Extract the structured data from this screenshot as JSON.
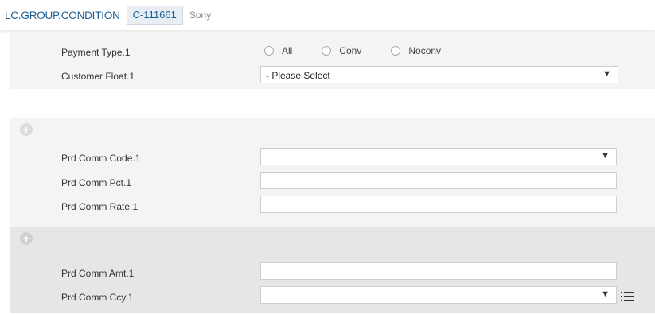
{
  "header": {
    "app_title": "LC.GROUP.CONDITION",
    "record_id": "C-111661",
    "record_name": "Sony"
  },
  "section1": {
    "payment_type_label": "Payment Type.1",
    "payment_type_options": [
      "All",
      "Conv",
      "Noconv"
    ],
    "customer_float_label": "Customer Float.1",
    "customer_float_value": "- Please Select"
  },
  "section2": {
    "add_icon": "plus-circle-icon",
    "prd_comm_code_label": "Prd Comm Code.1",
    "prd_comm_code_value": "",
    "prd_comm_pct_label": "Prd Comm Pct.1",
    "prd_comm_pct_value": "",
    "prd_comm_rate_label": "Prd Comm Rate.1",
    "prd_comm_rate_value": ""
  },
  "section3": {
    "add_icon": "plus-circle-icon",
    "prd_comm_amt_label": "Prd Comm Amt.1",
    "prd_comm_amt_value": "",
    "prd_comm_ccy_label": "Prd Comm Ccy.1",
    "prd_comm_ccy_value": "",
    "list_icon": "list-icon"
  },
  "colors": {
    "accent": "#1a5d93",
    "panel_light": "#f4f4f4",
    "panel_dark": "#e6e6e6"
  }
}
